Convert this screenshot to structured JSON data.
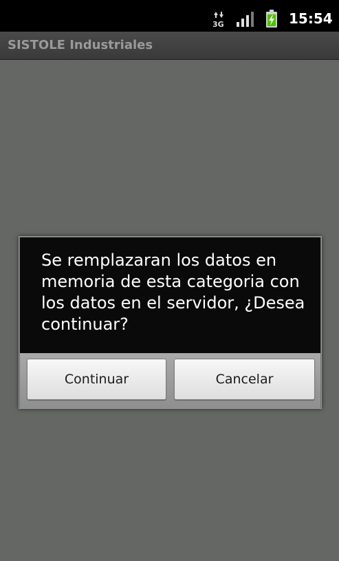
{
  "status_bar": {
    "network_icon": "3g-data-icon",
    "signal_icon": "signal-bars-icon",
    "battery_icon": "battery-charging-icon",
    "time": "15:54"
  },
  "app": {
    "title": "SISTOLE Industriales"
  },
  "dialog": {
    "message": "Se remplazaran los datos en memoria de esta categoria con los datos en el servidor, ¿Desea continuar?",
    "confirm_label": "Continuar",
    "cancel_label": "Cancelar"
  },
  "colors": {
    "battery_green": "#4fc000",
    "content_dim": "#656764",
    "dialog_message_bg": "#0a0a0a"
  }
}
